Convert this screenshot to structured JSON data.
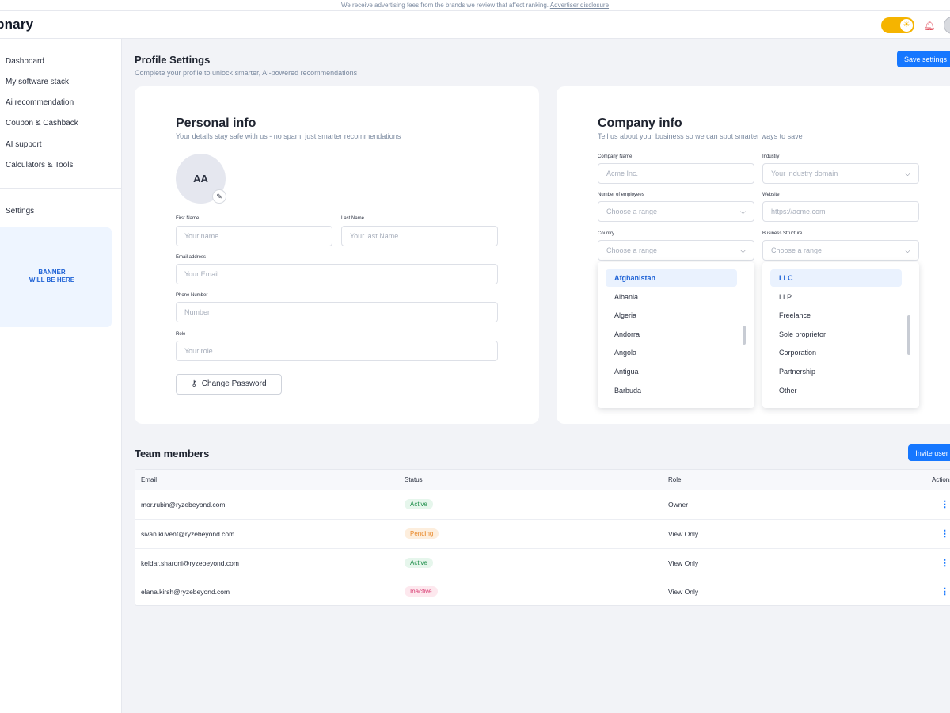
{
  "adbar": {
    "text": "We receive advertising fees from the brands we review that affect ranking.",
    "link": "Advertiser disclosure"
  },
  "header": {
    "logo": "pnary",
    "theme_icon": "sun-icon",
    "notification_icon": "bell-icon"
  },
  "sidebar": {
    "items": [
      {
        "label": "Dashboard"
      },
      {
        "label": "My software stack"
      },
      {
        "label": "Ai recommendation"
      },
      {
        "label": "Coupon & Cashback"
      },
      {
        "label": "AI support"
      },
      {
        "label": "Calculators & Tools"
      }
    ],
    "settings": "Settings",
    "banner_line1": "BANNER",
    "banner_line2": "WILL BE HERE"
  },
  "page": {
    "title": "Profile Settings",
    "subtitle": "Complete your profile to unlock smarter, AI-powered recommendations",
    "save_button": "Save settings"
  },
  "personal": {
    "title": "Personal info",
    "subtitle": "Your details stay safe with us - no spam, just smarter recommendations",
    "initials": "AA",
    "first_name": {
      "label": "First Name",
      "placeholder": "Your name"
    },
    "last_name": {
      "label": "Last Name",
      "placeholder": "Your last Name"
    },
    "email": {
      "label": "Email address",
      "placeholder": "Your Email"
    },
    "phone": {
      "label": "Phone Number",
      "placeholder": "Number"
    },
    "role": {
      "label": "Role",
      "placeholder": "Your role"
    },
    "change_password": "Change Password"
  },
  "company": {
    "title": "Company info",
    "subtitle": "Tell us about your business so we can spot smarter ways to save",
    "company_name": {
      "label": "Company Name",
      "placeholder": "Acme Inc."
    },
    "industry": {
      "label": "Industry",
      "placeholder": "Your industry domain"
    },
    "employees": {
      "label": "Number of employees",
      "placeholder": "Choose a range"
    },
    "website": {
      "label": "Website",
      "placeholder": "https://acme.com"
    },
    "country": {
      "label": "Country",
      "placeholder": "Choose a range"
    },
    "structure": {
      "label": "Business Structure",
      "placeholder": "Choose a range"
    },
    "country_options": [
      "Afghanistan",
      "Albania",
      "Algeria",
      "Andorra",
      "Angola",
      "Antigua",
      "Barbuda"
    ],
    "structure_options": [
      "LLC",
      "LLP",
      "Freelance",
      "Sole proprietor",
      "Corporation",
      "Partnership",
      "Other"
    ]
  },
  "team": {
    "title": "Team members",
    "invite_button": "Invite user",
    "columns": {
      "email": "Email",
      "status": "Status",
      "role": "Role",
      "actions": "Actions"
    },
    "rows": [
      {
        "email": "mor.rubin@ryzebeyond.com",
        "status": "Active",
        "role": "Owner"
      },
      {
        "email": "sivan.kuvent@ryzebeyond.com",
        "status": "Pending",
        "role": "View Only"
      },
      {
        "email": "keldar.sharoni@ryzebeyond.com",
        "status": "Active",
        "role": "View Only"
      },
      {
        "email": "elana.kirsh@ryzebeyond.com",
        "status": "Inactive",
        "role": "View Only"
      }
    ]
  }
}
